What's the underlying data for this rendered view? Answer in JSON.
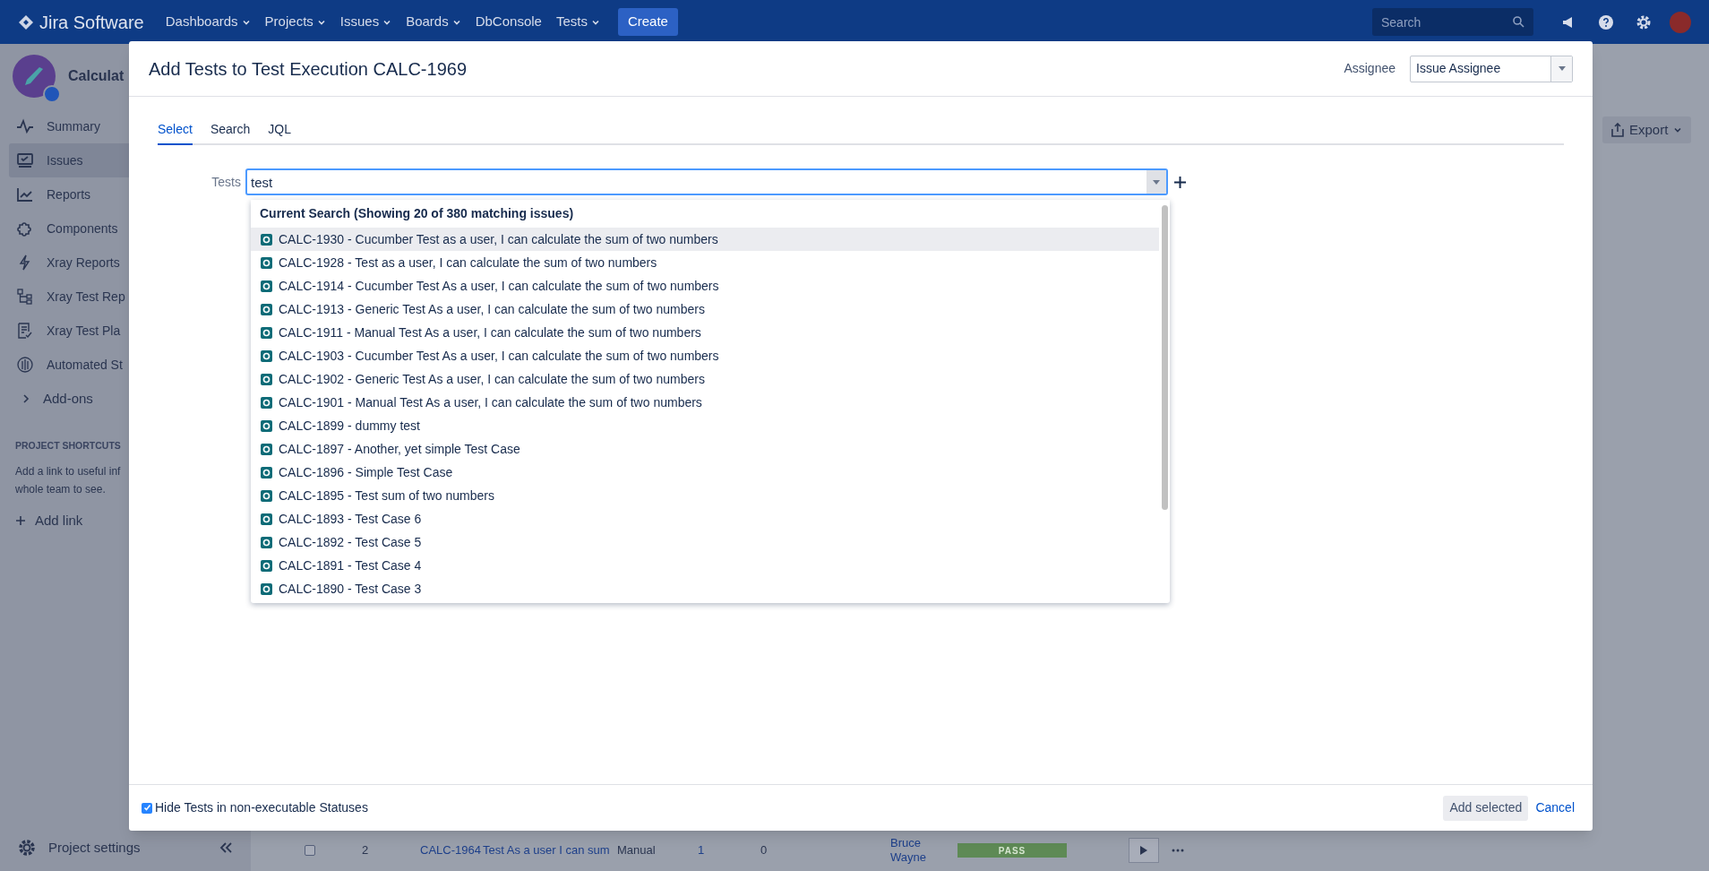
{
  "topbar": {
    "logo": "Jira Software",
    "nav": [
      {
        "label": "Dashboards",
        "dropdown": true
      },
      {
        "label": "Projects",
        "dropdown": true
      },
      {
        "label": "Issues",
        "dropdown": true
      },
      {
        "label": "Boards",
        "dropdown": true
      },
      {
        "label": "DbConsole",
        "dropdown": false
      },
      {
        "label": "Tests",
        "dropdown": true
      }
    ],
    "create": "Create",
    "search_placeholder": "Search"
  },
  "sidebar": {
    "project": "Calculat",
    "items": [
      {
        "label": "Summary",
        "selected": false
      },
      {
        "label": "Issues",
        "selected": true
      },
      {
        "label": "Reports",
        "selected": false
      },
      {
        "label": "Components",
        "selected": false
      },
      {
        "label": "Xray Reports",
        "selected": false
      },
      {
        "label": "Xray Test Rep",
        "selected": false
      },
      {
        "label": "Xray Test Pla",
        "selected": false
      },
      {
        "label": "Automated St",
        "selected": false
      }
    ],
    "addons": "Add-ons",
    "shortcuts_heading": "PROJECT SHORTCUTS",
    "shortcuts_text": [
      "Add a link to useful inf",
      "whole team to see."
    ],
    "add_link": "Add link",
    "settings": "Project settings"
  },
  "background": {
    "export": "Export",
    "row": {
      "checked": false,
      "rank": "2",
      "key": "CALC-1964",
      "summary": "Test As a user I can sum",
      "type": "Manual",
      "col_5": "1",
      "col_6": "0",
      "assignee": "Bruce Wayne",
      "status": "PASS"
    }
  },
  "modal": {
    "title": "Add Tests to Test Execution CALC-1969",
    "assignee_label": "Assignee",
    "assignee_value": "Issue Assignee",
    "tabs": [
      {
        "label": "Select",
        "selected": true
      },
      {
        "label": "Search",
        "selected": false
      },
      {
        "label": "JQL",
        "selected": false
      }
    ],
    "tests_label": "Tests",
    "tests_value": "test",
    "dropdown_heading": "Current Search (Showing 20 of 380 matching issues)",
    "results": [
      {
        "label": "CALC-1930 - Cucumber Test as a user, I can calculate the sum of two numbers",
        "selected": true
      },
      {
        "label": "CALC-1928 - Test as a user, I can calculate the sum of two numbers",
        "selected": false
      },
      {
        "label": "CALC-1914 - Cucumber Test As a user, I can calculate the sum of two numbers",
        "selected": false
      },
      {
        "label": "CALC-1913 - Generic Test As a user, I can calculate the sum of two numbers",
        "selected": false
      },
      {
        "label": "CALC-1911 - Manual Test As a user, I can calculate the sum of two numbers",
        "selected": false
      },
      {
        "label": "CALC-1903 - Cucumber Test As a user, I can calculate the sum of two numbers",
        "selected": false
      },
      {
        "label": "CALC-1902 - Generic Test As a user, I can calculate the sum of two numbers",
        "selected": false
      },
      {
        "label": "CALC-1901 - Manual Test As a user, I can calculate the sum of two numbers",
        "selected": false
      },
      {
        "label": "CALC-1899 - dummy test",
        "selected": false
      },
      {
        "label": "CALC-1897 - Another, yet simple Test Case",
        "selected": false
      },
      {
        "label": "CALC-1896 - Simple Test Case",
        "selected": false
      },
      {
        "label": "CALC-1895 - Test sum of two numbers",
        "selected": false
      },
      {
        "label": "CALC-1893 - Test Case 6",
        "selected": false
      },
      {
        "label": "CALC-1892 - Test Case 5",
        "selected": false
      },
      {
        "label": "CALC-1891 - Test Case 4",
        "selected": false
      },
      {
        "label": "CALC-1890 - Test Case 3",
        "selected": false
      }
    ],
    "hide_checked": true,
    "hide_label": "Hide Tests in non-executable Statuses",
    "add_selected": "Add selected",
    "cancel": "Cancel"
  }
}
